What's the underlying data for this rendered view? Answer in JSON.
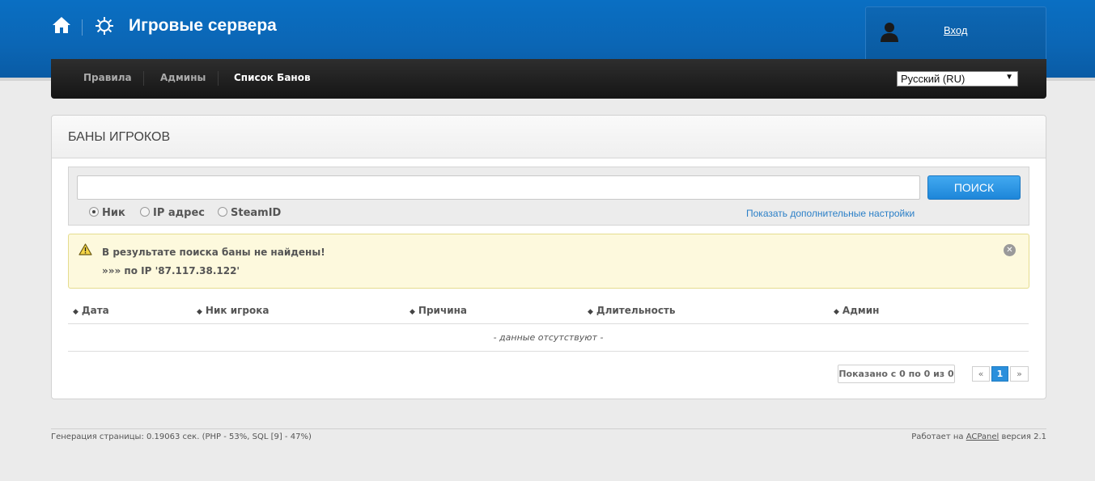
{
  "header": {
    "title": "Игровые сервера",
    "home_icon": "home-icon",
    "logo_icon": "gear-icon",
    "login_label": "Вход",
    "user_icon": "user-icon"
  },
  "nav": {
    "items": [
      {
        "label": "Правила",
        "active": false
      },
      {
        "label": "Админы",
        "active": false
      },
      {
        "label": "Список Банов",
        "active": true
      }
    ],
    "language": "Русский (RU)"
  },
  "panel": {
    "title": "БАНЫ ИГРОКОВ"
  },
  "search": {
    "value": "",
    "button_label": "ПОИСК",
    "options": [
      "Ник",
      "IP адрес",
      "SteamID"
    ],
    "selected": "Ник",
    "more_settings": "Показать дополнительные настройки"
  },
  "alert": {
    "title": "В результате поиска баны не найдены!",
    "detail": "»»» по IP '87.117.38.122'"
  },
  "table": {
    "columns": [
      "Дата",
      "Ник игрока",
      "Причина",
      "Длительность",
      "Админ"
    ],
    "empty": "- данные отсутствуют -"
  },
  "pagination": {
    "info": "Показано с 0 по 0 из 0",
    "prev": "«",
    "current": "1",
    "next": "»"
  },
  "footer": {
    "generation": "Генерация страницы: 0.19063 сек. (PHP - 53%, SQL [9] - 47%)",
    "powered_prefix": "Работает на",
    "powered_link": "ACPanel",
    "powered_suffix": "версия 2.1"
  },
  "colors": {
    "header_blue": "#0b66b5",
    "accent": "#2a8fdc",
    "alert_bg": "#fdf9dd"
  }
}
